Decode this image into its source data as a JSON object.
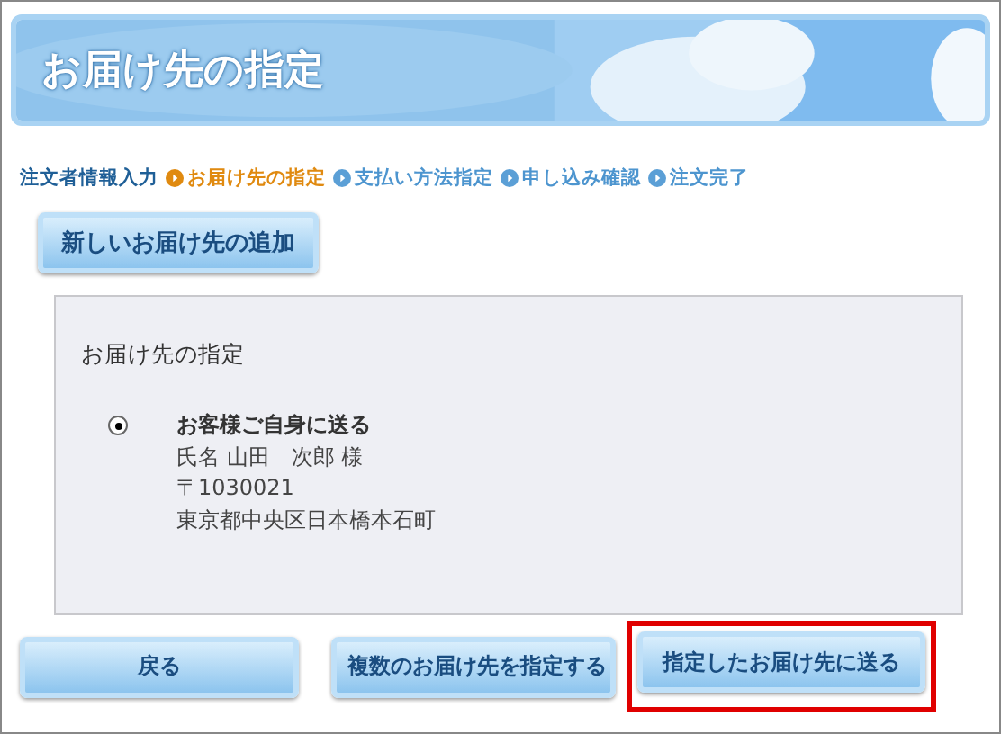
{
  "banner": {
    "title": "お届け先の指定",
    "kind": "picture"
  },
  "steps": [
    {
      "label": "注文者情報入力",
      "done": true,
      "selected": false
    },
    {
      "label": "お届け先の指定",
      "done": false,
      "selected": true
    },
    {
      "label": "支払い方法指定",
      "done": false,
      "selected": false
    },
    {
      "label": "申し込み確認",
      "done": false,
      "selected": false
    },
    {
      "label": "注文完了",
      "done": false,
      "selected": false
    }
  ],
  "add_button": "新しいお届け先の追加",
  "panel": {
    "heading": "お届け先の指定",
    "options": [
      {
        "label": "お客様ご自身に送る",
        "selected": true,
        "lines": [
          "氏名 山田　次郎 様",
          "〒1030021",
          "東京都中央区日本橋本石町"
        ]
      }
    ]
  },
  "buttons": [
    {
      "label": "戻る",
      "highlighted": false
    },
    {
      "label": "複数のお届け先を指定する",
      "highlighted": false
    },
    {
      "label": "指定したお届け先に送る",
      "highlighted": true
    }
  ]
}
